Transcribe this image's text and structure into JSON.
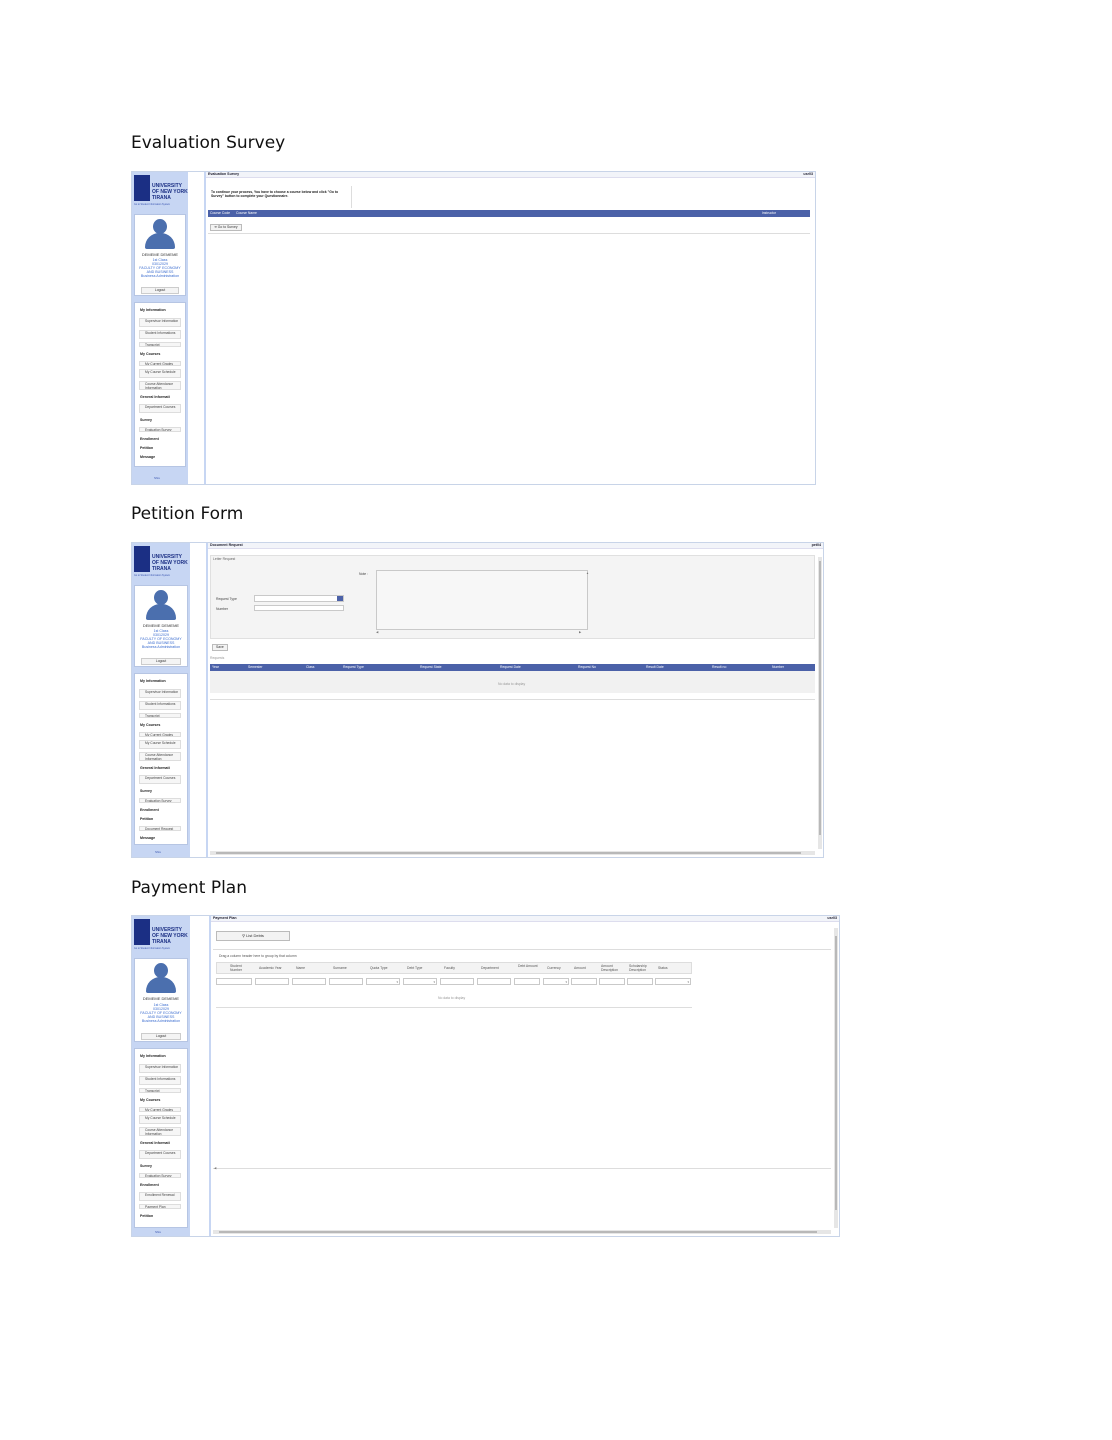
{
  "headings": {
    "evaluation": "Evaluation Survey",
    "petition": "Petition Form",
    "payment": "Payment Plan"
  },
  "sidebar": {
    "logo_lines": [
      "UNIVERSITY",
      "OF NEW YORK",
      "TIRANA"
    ],
    "tagline": "Go to Student Information System",
    "name": "DEMEME DEMEME",
    "info": [
      "1st Class",
      "03012029",
      "FACULTY OF ECONOMY",
      "AND BUSINESS",
      "Business Administration"
    ],
    "logout": "Logout",
    "groups": {
      "my_information": "My Information",
      "my_courses": "My Courses",
      "general_information": "General Informati",
      "survey": "Survey",
      "enrollment": "Enrollment",
      "petition": "Petition",
      "message": "Message"
    },
    "items": {
      "supervisor_information": "Supervisor Information",
      "student_informations": "Student Informations",
      "transcript": "Transcript",
      "my_current_grades": "My Current Grades",
      "my_course_schedule": "My Course Schedule",
      "course_attendance_information": "Course Attendance Information",
      "department_courses": "Department Courses",
      "evaluation_survey": "Evaluation Survey",
      "document_request": "Document Request",
      "enrollment_renewal": "Enrollment Renewal",
      "payment_plan": "Payment Plan"
    },
    "footer": "Shis"
  },
  "evaluation": {
    "title": "Evaluation Survey",
    "user": "usr03",
    "instructions": "To continue your process, You have to choose a course below and click \"Go to Survey\" button to complete your Questionnaire.",
    "columns": [
      "Course Code",
      "Course Name",
      "Instructor"
    ],
    "go_button": "Go to Survey"
  },
  "petition": {
    "title": "Document Request",
    "user": "pet04",
    "panel": "Letter Request",
    "note_label": "Note :",
    "request_type_label": "Request Type",
    "number_label": "Number",
    "save_button": "Save",
    "requests_label": "Requests",
    "columns": [
      "Year",
      "Semester",
      "Class",
      "Request Type",
      "Request State",
      "Request Date",
      "Request No",
      "Result Date",
      "Result no",
      "Number"
    ],
    "empty": "No data to display"
  },
  "payment": {
    "title": "Payment Plan",
    "user": "usr03",
    "list_button": "List Debts",
    "group_hint": "Drag a column header here to group by that column",
    "columns": [
      "Student Number",
      "Academic Year",
      "Name",
      "Surname",
      "Quota Type",
      "Debt Type",
      "Faculty",
      "Department",
      "Debt Amount",
      "Currency",
      "Amount",
      "Amount Description",
      "Scholarship Description",
      "Status"
    ],
    "empty": "No data to display"
  }
}
